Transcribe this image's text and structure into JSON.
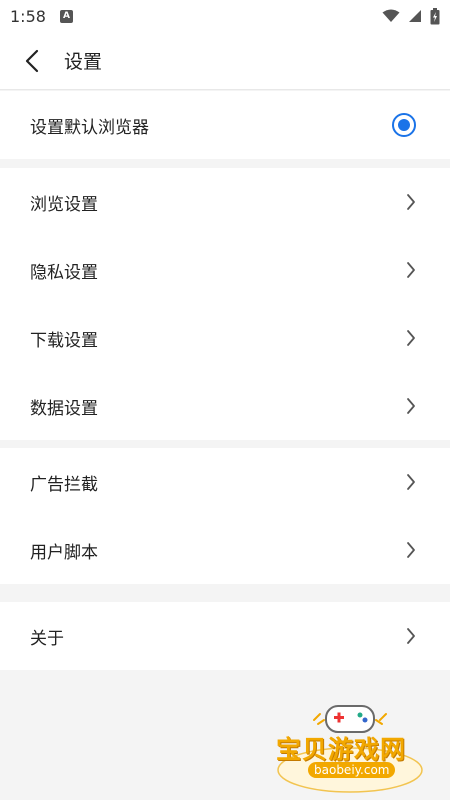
{
  "status_bar": {
    "time": "1:58",
    "notification_icon": "A"
  },
  "header": {
    "back_icon": "chevron-left-icon",
    "title": "设置"
  },
  "default_browser": {
    "label": "设置默认浏览器",
    "selected": true,
    "accent_color": "#1a73e8"
  },
  "group1": {
    "items": [
      {
        "label": "浏览设置"
      },
      {
        "label": "隐私设置"
      },
      {
        "label": "下载设置"
      },
      {
        "label": "数据设置"
      }
    ]
  },
  "group2": {
    "items": [
      {
        "label": "广告拦截"
      },
      {
        "label": "用户脚本"
      }
    ]
  },
  "group3": {
    "items": [
      {
        "label": "关于"
      }
    ]
  },
  "watermark": {
    "text": "宝贝游戏网",
    "url": "baobeiy.com"
  }
}
